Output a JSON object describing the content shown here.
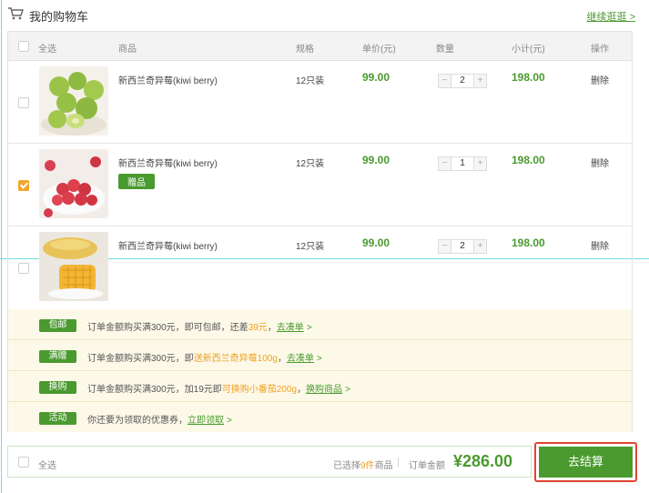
{
  "header": {
    "title": "我的购物车",
    "continue_label": "继续逛逛 >"
  },
  "table_head": {
    "select_all": "全选",
    "product": "商品",
    "spec": "规格",
    "unit_price": "单价(元)",
    "quantity": "数量",
    "subtotal": "小计(元)",
    "action": "操作"
  },
  "items": [
    {
      "name": "新西兰奇异莓(kiwi berry)",
      "spec": "12只装",
      "price": "99.00",
      "quantity": "2",
      "subtotal": "198.00",
      "delete": "删除",
      "checked": false,
      "badge": "",
      "image": "green-kiwi-berries"
    },
    {
      "name": "新西兰奇异莓(kiwi berry)",
      "spec": "12只装",
      "price": "99.00",
      "quantity": "1",
      "subtotal": "198.00",
      "delete": "删除",
      "checked": true,
      "badge": "赠品",
      "image": "raspberries"
    },
    {
      "name": "新西兰奇异莓(kiwi berry)",
      "spec": "12只装",
      "price": "99.00",
      "quantity": "2",
      "subtotal": "198.00",
      "delete": "删除",
      "checked": false,
      "badge": "",
      "image": "mango"
    }
  ],
  "qty_controls": {
    "minus": "−",
    "plus": "+"
  },
  "promotions": [
    {
      "tag": "包邮",
      "text_before": "订单金额购买满300元，即可包邮，还差",
      "highlight": "39元",
      "text_after": "，",
      "link": "去凑单"
    },
    {
      "tag": "满赠",
      "text_before": "订单金额购买满300元，即",
      "highlight": "送新西兰奇异莓100g",
      "text_after": "，",
      "link": "去凑单"
    },
    {
      "tag": "换购",
      "text_before": "订单金额购买满300元，加19元即",
      "highlight": "可换购小番茄200g",
      "text_after": "，",
      "link": "换购商品"
    },
    {
      "tag": "活动",
      "text_before": "你还要为领取的优惠券，",
      "highlight": "",
      "text_after": "",
      "link": "立即领取"
    }
  ],
  "footer": {
    "select_all": "全选",
    "selected_prefix": "已选择",
    "selected_count": "9件",
    "selected_suffix": "商品",
    "separator": "|",
    "amount_label": "订单金额",
    "total": "¥286.00",
    "checkout": "去结算"
  },
  "colors": {
    "accent_green": "#4a9a2f",
    "highlight_orange": "#f0a020",
    "checkout_frame_red": "#e04432",
    "promo_bg": "#fdf9e9"
  }
}
